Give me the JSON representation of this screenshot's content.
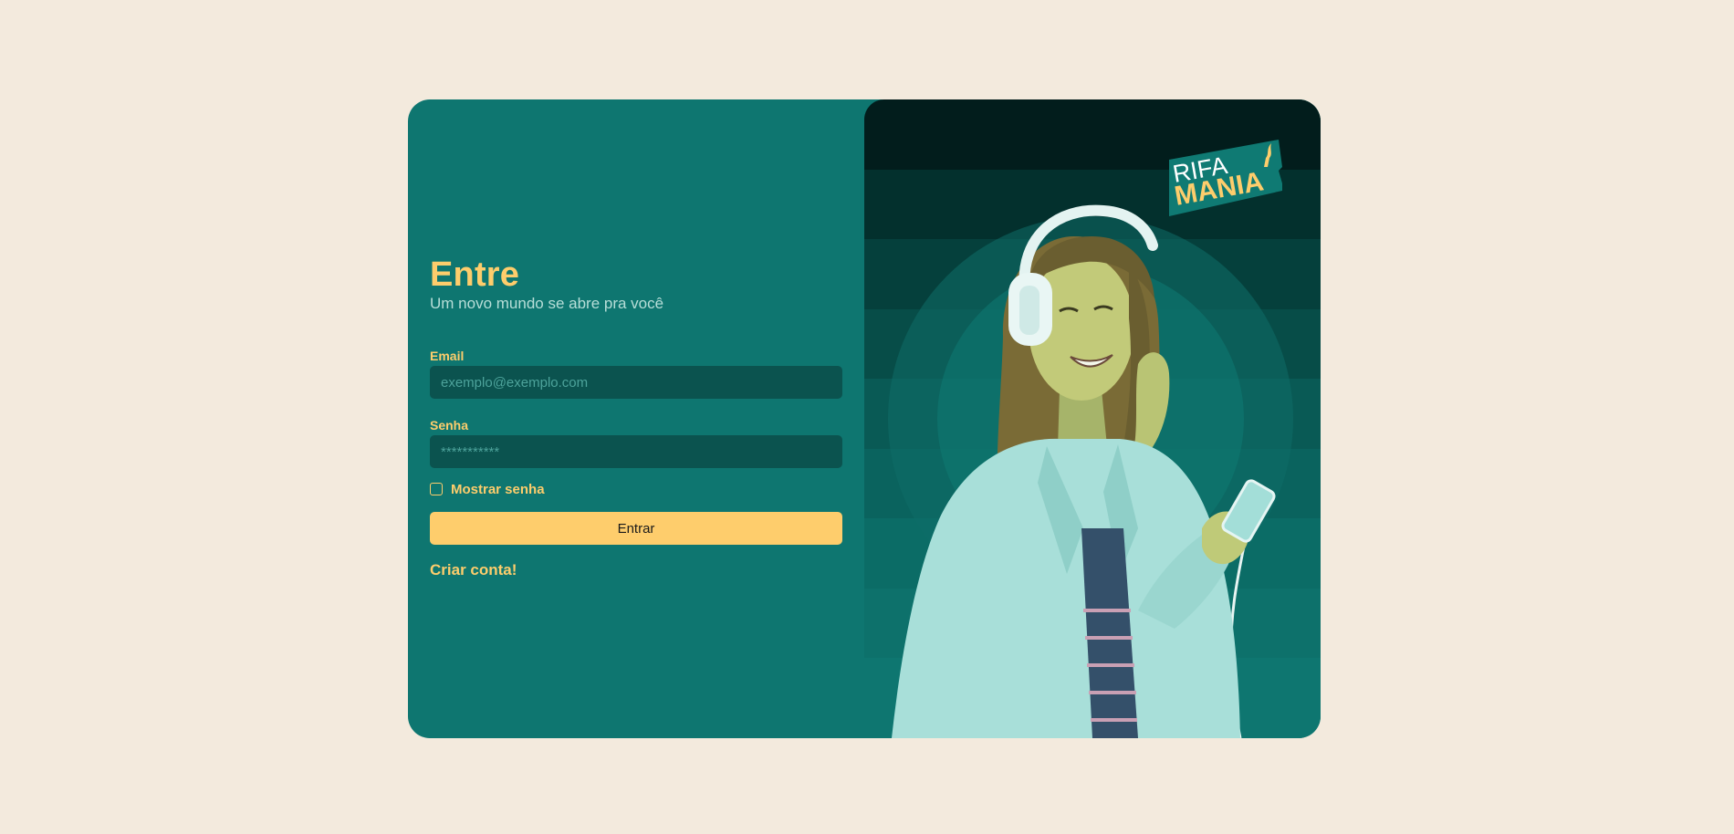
{
  "login": {
    "title": "Entre",
    "subtitle": "Um novo mundo se abre pra você",
    "email": {
      "label": "Email",
      "placeholder": "exemplo@exemplo.com",
      "value": ""
    },
    "password": {
      "label": "Senha",
      "placeholder": "***********",
      "value": ""
    },
    "show_password": {
      "label": "Mostrar senha",
      "checked": false
    },
    "submit_label": "Entrar",
    "create_account_label": "Criar conta!"
  },
  "hero": {
    "logo_line1": "RIFA",
    "logo_line2": "MANIA",
    "image_subject": "young woman with headphones holding a phone"
  },
  "colors": {
    "page_background": "#f3eadd",
    "card_teal": "#0e7670",
    "input_dark_teal": "#0b534f",
    "accent_yellow": "#fdcd6c",
    "subtitle_text": "#b7ded8"
  }
}
